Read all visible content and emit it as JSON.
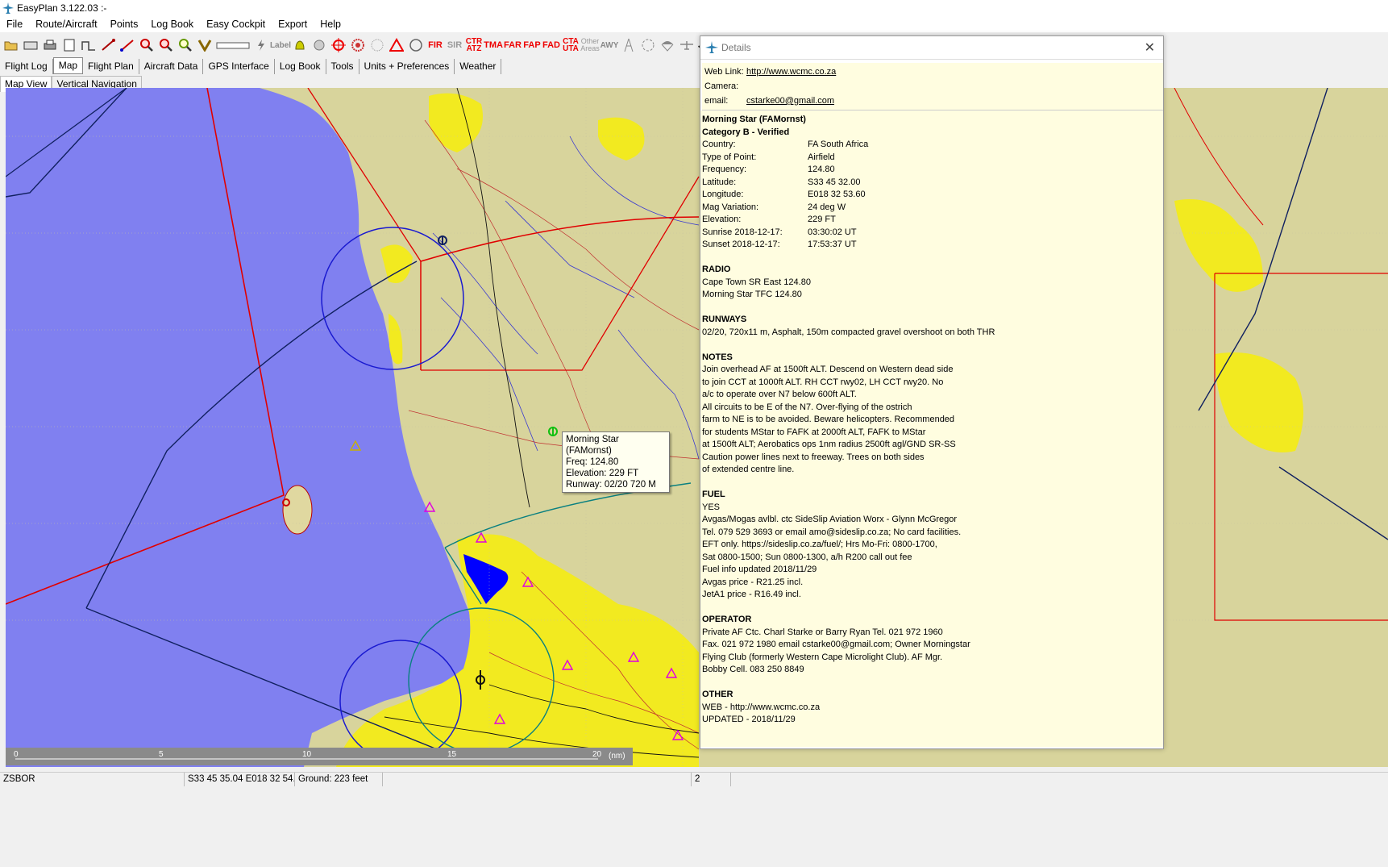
{
  "app": {
    "title": "EasyPlan 3.122.03 :-"
  },
  "menu": [
    "File",
    "Route/Aircraft",
    "Points",
    "Log Book",
    "Easy Cockpit",
    "Export",
    "Help"
  ],
  "toolbar": {
    "label_text": "Label",
    "fir": "FIR",
    "sir": "SIR",
    "ctr_atz": "CTR ATZ",
    "tma": "TMA",
    "far": "FAR",
    "fap": "FAP",
    "fad": "FAD",
    "cta_uta": "CTA UTA",
    "other_areas": "Other Areas",
    "awy": "AWY"
  },
  "tabs": [
    "Flight Log",
    "Map",
    "Flight Plan",
    "Aircraft Data",
    "GPS Interface",
    "Log Book",
    "Tools",
    "Units + Preferences",
    "Weather"
  ],
  "active_tab": "Map",
  "subtabs": [
    "Map View",
    "Vertical Navigation"
  ],
  "scale": {
    "ticks": [
      "0",
      "5",
      "10",
      "15",
      "20"
    ],
    "unit": "(nm)"
  },
  "tooltip": {
    "name": "Morning Star (FAMornst)",
    "freq": "Freq: 124.80",
    "elev": "Elevation: 229 FT",
    "runway": "Runway: 02/20  720 M"
  },
  "details": {
    "title": "Details",
    "web_link_label": "Web Link:",
    "web_link": "http://www.wcmc.co.za",
    "camera_label": "Camera:",
    "email_label": "email:",
    "email": "cstarke00@gmail.com",
    "name": "Morning Star (FAMornst)",
    "category": "Category B - Verified",
    "fields": [
      {
        "k": "Country:",
        "v": "FA South Africa"
      },
      {
        "k": "Type of Point:",
        "v": "Airfield"
      },
      {
        "k": "Frequency:",
        "v": "124.80"
      },
      {
        "k": "Latitude:",
        "v": "S33 45 32.00"
      },
      {
        "k": "Longitude:",
        "v": "E018 32 53.60"
      },
      {
        "k": "Mag Variation:",
        "v": "24 deg W"
      },
      {
        "k": "Elevation:",
        "v": "229 FT"
      },
      {
        "k": "Sunrise 2018-12-17:",
        "v": "03:30:02 UT"
      },
      {
        "k": "Sunset 2018-12-17:",
        "v": "17:53:37 UT"
      }
    ],
    "radio_h": "RADIO",
    "radio": [
      "Cape Town SR East 124.80",
      "Morning Star TFC 124.80"
    ],
    "runways_h": "RUNWAYS",
    "runways": [
      "02/20, 720x11 m, Asphalt, 150m compacted gravel overshoot on both THR"
    ],
    "notes_h": "NOTES",
    "notes": [
      "Join overhead AF at 1500ft ALT. Descend on Western dead side",
      "to join CCT at 1000ft ALT. RH CCT rwy02, LH CCT rwy20. No",
      "a/c to operate over N7 below 600ft ALT.",
      "All circuits to be E of the N7. Over-flying of the ostrich",
      "farm to NE is to be avoided. Beware helicopters. Recommended",
      "for students  MStar to FAFK at 2000ft ALT, FAFK to MStar",
      "at 1500ft ALT; Aerobatics ops 1nm radius 2500ft agl/GND SR-SS",
      "Caution  power lines next to freeway. Trees on both sides",
      "of extended centre line."
    ],
    "fuel_h": "FUEL",
    "fuel": [
      "YES",
      "Avgas/Mogas avlbl. ctc SideSlip Aviation Worx - Glynn McGregor",
      "Tel. 079 529 3693 or email amo@sideslip.co.za; No card facilities.",
      "EFT only. https://sideslip.co.za/fuel/; Hrs Mo-Fri: 0800-1700,",
      "Sat 0800-1500; Sun 0800-1300, a/h R200 call out fee",
      "Fuel info updated 2018/11/29",
      "Avgas price - R21.25 incl.",
      "JetA1 price - R16.49 incl."
    ],
    "operator_h": "OPERATOR",
    "operator": [
      "Private AF Ctc. Charl Starke or Barry Ryan Tel. 021 972 1960",
      "Fax. 021 972 1980 email  cstarke00@gmail.com;  Owner  Morningstar",
      "Flying Club (formerly Western Cape Microlight Club). AF Mgr.",
      "Bobby Cell. 083 250 8849"
    ],
    "other_h": "OTHER",
    "other": [
      "WEB - http://www.wcmc.co.za",
      "UPDATED - 2018/11/29"
    ]
  },
  "status": {
    "station": "ZSBOR",
    "coords": "S33 45 35.04  E018 32 54.70",
    "ground": "Ground: 223 feet",
    "blank": "",
    "count": "2"
  },
  "colors": {
    "sea": "#8080f0",
    "land": "#d6d29a",
    "urban": "#f0e800",
    "lake": "#0000ff",
    "panel": "#fffde0"
  }
}
